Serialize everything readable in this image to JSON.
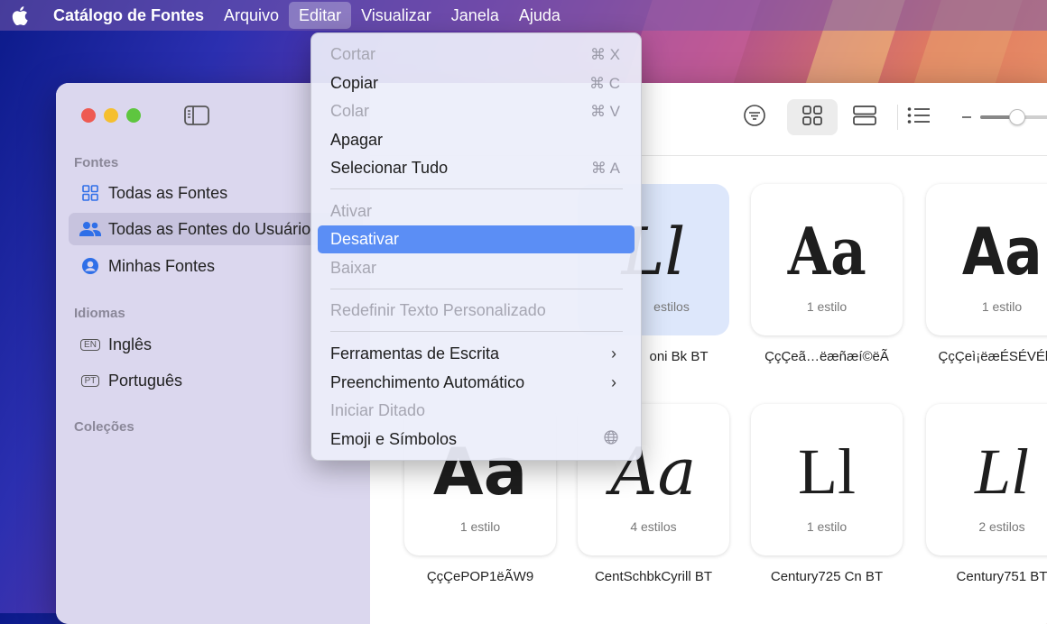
{
  "menubar": {
    "app_name": "Catálogo de Fontes",
    "items": [
      "Arquivo",
      "Editar",
      "Visualizar",
      "Janela",
      "Ajuda"
    ]
  },
  "sidebar": {
    "section_fonts": "Fontes",
    "fonts_items": [
      {
        "label": "Todas as Fontes",
        "icon": "grid-icon"
      },
      {
        "label": "Todas as Fontes do Usuário",
        "icon": "users-icon"
      },
      {
        "label": "Minhas Fontes",
        "icon": "person-circle-icon"
      }
    ],
    "section_languages": "Idiomas",
    "language_items": [
      {
        "badge": "EN",
        "label": "Inglês"
      },
      {
        "badge": "PT",
        "label": "Português"
      }
    ],
    "section_collections": "Coleções"
  },
  "edit_menu": {
    "items": [
      {
        "label": "Cortar",
        "shortcut": "⌘ X",
        "disabled": true
      },
      {
        "label": "Copiar",
        "shortcut": "⌘ C",
        "disabled": false
      },
      {
        "label": "Colar",
        "shortcut": "⌘ V",
        "disabled": true
      },
      {
        "label": "Apagar",
        "shortcut": "",
        "disabled": false
      },
      {
        "label": "Selecionar Tudo",
        "shortcut": "⌘ A",
        "disabled": false
      },
      {
        "label": "Ativar",
        "disabled": true
      },
      {
        "label": "Desativar",
        "highlighted": true
      },
      {
        "label": "Baixar",
        "disabled": true
      },
      {
        "label": "Redefinir Texto Personalizado",
        "disabled": true
      },
      {
        "label": "Ferramentas de Escrita",
        "submenu": true
      },
      {
        "label": "Preenchimento Automático",
        "submenu": true
      },
      {
        "label": "Iniciar Ditado",
        "disabled": true
      },
      {
        "label": "Emoji e Símbolos",
        "icon": "globe-icon"
      }
    ]
  },
  "fonts": [
    {
      "glyph": "Ll",
      "styles": "estilos",
      "name": "oni Bk BT"
    },
    {
      "glyph": "Aa",
      "styles": "1 estilo",
      "name": "ÇçÇeã…ëæñæí©ëÃ"
    },
    {
      "glyph": "Aa",
      "styles": "1 estilo",
      "name": "ÇçÇeì¡ëæÉSÉVÉb Ã"
    },
    {
      "glyph": "Aa",
      "styles": "1 estilo",
      "name": "ÇçÇePOP1ëÃW9"
    },
    {
      "glyph": "Aa",
      "styles": "4 estilos",
      "name": "CentSchbkCyrill BT"
    },
    {
      "glyph": "Ll",
      "styles": "1 estilo",
      "name": "Century725 Cn BT"
    },
    {
      "glyph": "Ll",
      "styles": "2 estilos",
      "name": "Century751 BT"
    }
  ],
  "colors": {
    "highlight": "#5b8ef5",
    "selected_card": "#dde7fb",
    "traffic_red": "#ee5a52",
    "traffic_yellow": "#f5bf2f",
    "traffic_green": "#5ec63f"
  }
}
